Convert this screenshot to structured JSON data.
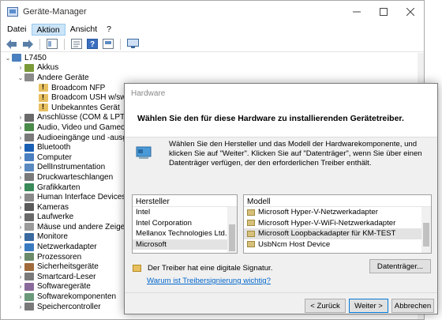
{
  "window": {
    "title": "Geräte-Manager"
  },
  "menu": [
    "Datei",
    "Aktion",
    "Ansicht",
    "?"
  ],
  "tree": {
    "root": "L7450",
    "nodes": [
      {
        "label": "Akkus",
        "level": 1,
        "expanded": false,
        "icon_color": "#7a9a3a",
        "warn": false
      },
      {
        "label": "Andere Geräte",
        "level": 1,
        "expanded": true,
        "icon_color": "#8a8a8a",
        "warn": false
      },
      {
        "label": "Broadcom NFP",
        "level": 2,
        "expanded": null,
        "icon_color": "#e8c060",
        "warn": true
      },
      {
        "label": "Broadcom USH w/swipe se",
        "level": 2,
        "expanded": null,
        "icon_color": "#e8c060",
        "warn": true
      },
      {
        "label": "Unbekanntes Gerät",
        "level": 2,
        "expanded": null,
        "icon_color": "#e8c060",
        "warn": true
      },
      {
        "label": "Anschlüsse (COM & LPT)",
        "level": 1,
        "expanded": false,
        "icon_color": "#6a6a6a",
        "warn": false
      },
      {
        "label": "Audio, Video und Gamecontro",
        "level": 1,
        "expanded": false,
        "icon_color": "#4a8a4a",
        "warn": false
      },
      {
        "label": "Audioeingänge und -ausgäng",
        "level": 1,
        "expanded": false,
        "icon_color": "#7a7a7a",
        "warn": false
      },
      {
        "label": "Bluetooth",
        "level": 1,
        "expanded": false,
        "icon_color": "#1a5fb4",
        "warn": false
      },
      {
        "label": "Computer",
        "level": 1,
        "expanded": false,
        "icon_color": "#4a7fc0",
        "warn": false
      },
      {
        "label": "DellInstrumentation",
        "level": 1,
        "expanded": false,
        "icon_color": "#5a8ac0",
        "warn": false
      },
      {
        "label": "Druckwarteschlangen",
        "level": 1,
        "expanded": false,
        "icon_color": "#7a7a7a",
        "warn": false
      },
      {
        "label": "Grafikkarten",
        "level": 1,
        "expanded": false,
        "icon_color": "#3a8a5a",
        "warn": false
      },
      {
        "label": "Human Interface Devices",
        "level": 1,
        "expanded": false,
        "icon_color": "#8a8a8a",
        "warn": false
      },
      {
        "label": "Kameras",
        "level": 1,
        "expanded": false,
        "icon_color": "#5a5a5a",
        "warn": false
      },
      {
        "label": "Laufwerke",
        "level": 1,
        "expanded": false,
        "icon_color": "#6a6a6a",
        "warn": false
      },
      {
        "label": "Mäuse und andere Zeigegerät",
        "level": 1,
        "expanded": false,
        "icon_color": "#9a9a9a",
        "warn": false
      },
      {
        "label": "Monitore",
        "level": 1,
        "expanded": false,
        "icon_color": "#3a6aa0",
        "warn": false
      },
      {
        "label": "Netzwerkadapter",
        "level": 1,
        "expanded": false,
        "icon_color": "#3a7ac0",
        "warn": false
      },
      {
        "label": "Prozessoren",
        "level": 1,
        "expanded": false,
        "icon_color": "#6a8a6a",
        "warn": false
      },
      {
        "label": "Sicherheitsgeräte",
        "level": 1,
        "expanded": false,
        "icon_color": "#a06a3a",
        "warn": false
      },
      {
        "label": "Smartcard-Leser",
        "level": 1,
        "expanded": false,
        "icon_color": "#7a7a7a",
        "warn": false
      },
      {
        "label": "Softwaregeräte",
        "level": 1,
        "expanded": false,
        "icon_color": "#8a6a9a",
        "warn": false
      },
      {
        "label": "Softwarekomponenten",
        "level": 1,
        "expanded": false,
        "icon_color": "#6a9a7a",
        "warn": false
      },
      {
        "label": "Speichercontroller",
        "level": 1,
        "expanded": false,
        "icon_color": "#7a7a7a",
        "warn": false
      }
    ]
  },
  "dialog": {
    "title": "Hardware",
    "heading": "Wählen Sie den für diese Hardware zu installierenden Gerätetreiber.",
    "info": "Wählen Sie den Hersteller und das Modell der Hardwarekomponente, und klicken Sie auf \"Weiter\". Klicken Sie auf \"Datenträger\", wenn Sie über einen Datenträger verfügen, der den erforderlichen Treiber enthält.",
    "manufacturer_header": "Hersteller",
    "manufacturers": [
      "Intel",
      "Intel Corporation",
      "Mellanox Technologies Ltd.",
      "Microsoft"
    ],
    "manufacturer_selected": "Microsoft",
    "model_header": "Modell",
    "models": [
      "Microsoft Hyper-V-Netzwerkadapter",
      "Microsoft Hyper-V-WiFi-Netzwerkadapter",
      "Microsoft Loopbackadapter für KM-TEST",
      "UsbNcm Host Device"
    ],
    "model_selected": "Microsoft Loopbackadapter für KM-TEST",
    "signature": "Der Treiber hat eine digitale Signatur.",
    "signature_link": "Warum ist Treibersignierung wichtig?",
    "disk_button": "Datenträger...",
    "back_button": "< Zurück",
    "next_button": "Weiter >",
    "cancel_button": "Abbrechen"
  }
}
